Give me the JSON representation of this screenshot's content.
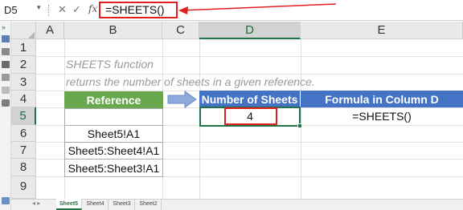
{
  "formula_bar": {
    "name_box": "D5",
    "cancel_glyph": "✕",
    "enter_glyph": "✓",
    "fx_label": "fx",
    "formula": "=SHEETS()"
  },
  "columns": [
    "A",
    "B",
    "C",
    "D",
    "E"
  ],
  "rows": [
    "1",
    "2",
    "3",
    "4",
    "5",
    "6",
    "7",
    "8",
    "9"
  ],
  "notes": {
    "line1": "SHEETS function",
    "line2": "returns the number of sheets in a given reference."
  },
  "reference_table": {
    "header": "Reference",
    "values": [
      "",
      "Sheet5!A1",
      "Sheet5:Sheet4!A1",
      "Sheet5:Sheet3!A1"
    ]
  },
  "result_table": {
    "headers": [
      "Number of Sheets",
      "Formula in Column D"
    ],
    "result": "4",
    "formula_text": "=SHEETS()"
  },
  "sheet_tabs": [
    "Sheet5",
    "Sheet4",
    "Sheet3",
    "Sheet2"
  ],
  "active_sheet": "Sheet5",
  "colors": {
    "green_header": "#6aa84f",
    "blue_header": "#4472c4",
    "annotation_red": "#e02020",
    "selection_green": "#217346"
  }
}
